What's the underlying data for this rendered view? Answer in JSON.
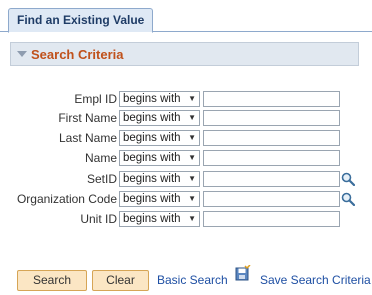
{
  "tab": {
    "label": "Find an Existing Value"
  },
  "group": {
    "title": "Search Criteria"
  },
  "fields": [
    {
      "label": "Empl ID",
      "operator": "begins with",
      "value": "",
      "lookup": false
    },
    {
      "label": "First Name",
      "operator": "begins with",
      "value": "",
      "lookup": false
    },
    {
      "label": "Last Name",
      "operator": "begins with",
      "value": "",
      "lookup": false
    },
    {
      "label": "Name",
      "operator": "begins with",
      "value": "",
      "lookup": false
    },
    {
      "label": "SetID",
      "operator": "begins with",
      "value": "",
      "lookup": true
    },
    {
      "label": "Organization Code",
      "operator": "begins with",
      "value": "",
      "lookup": true
    },
    {
      "label": "Unit ID",
      "operator": "begins with",
      "value": "",
      "lookup": false
    }
  ],
  "actions": {
    "search_label": "Search",
    "clear_label": "Clear",
    "basic_search_label": "Basic Search",
    "save_criteria_label": "Save Search Criteria"
  },
  "colors": {
    "group_title": "#c0511b",
    "link": "#1e4fa3",
    "button_bg": "#fbe6c4",
    "tab_bg": "#dfe9f5"
  },
  "icons": {
    "collapse": "triangle-down-icon",
    "lookup": "magnifier-icon",
    "save": "save-criteria-icon",
    "dropdown": "dropdown-arrow-icon"
  }
}
